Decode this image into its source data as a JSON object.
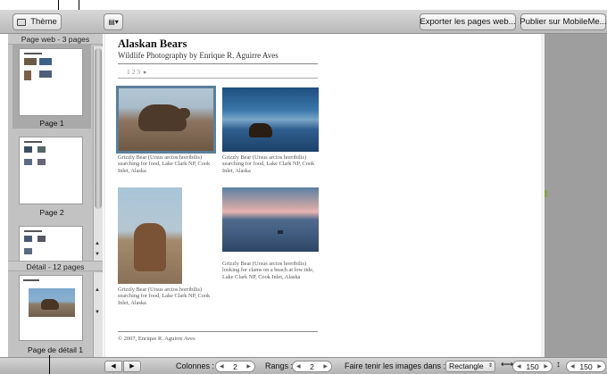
{
  "toolbar": {
    "theme_label": "Thème",
    "export_label": "Exporter les pages web...",
    "publish_label": "Publier sur MobileMe..."
  },
  "sidebar": {
    "web_header": "Page web - 3 pages",
    "pages": [
      {
        "label": "Page 1"
      },
      {
        "label": "Page 2"
      }
    ],
    "detail_header": "Détail - 12 pages",
    "detail_label": "Page de détail 1"
  },
  "webpage": {
    "title": "Alaskan Bears",
    "subtitle": "Wildlife Photography by Enrique R. Aguirre Aves",
    "pagination": "1 2 3",
    "pagination_arrow": "▸",
    "photos": [
      {
        "caption": "Grizzly Bear (Ursus arctos horribilis) searching for food, Lake Clark NP, Cook Inlet, Alaska"
      },
      {
        "caption": "Grizzly Bear (Ursus arctos horribilis) searching for food, Lake Clark NP, Cook Inlet, Alaska"
      },
      {
        "caption": "Grizzly Bear (Ursus arctos horribilis) searching for food, Lake Clark NP, Cook Inlet, Alaska"
      },
      {
        "caption": "Grizzly Bear (Ursus arctos horribilis) looking for clams on a beach at low tide, Lake Clark NP, Cook Inlet, Alaska"
      }
    ],
    "footer": "© 2007, Enrique R. Aguirre Aves"
  },
  "statusbar": {
    "columns_label": "Colonnes :",
    "columns_value": "2",
    "rows_label": "Rangs :",
    "rows_value": "2",
    "fit_label": "Faire tenir les images dans :",
    "fit_value": "Rectangle",
    "width_value": "150",
    "height_value": "150"
  }
}
